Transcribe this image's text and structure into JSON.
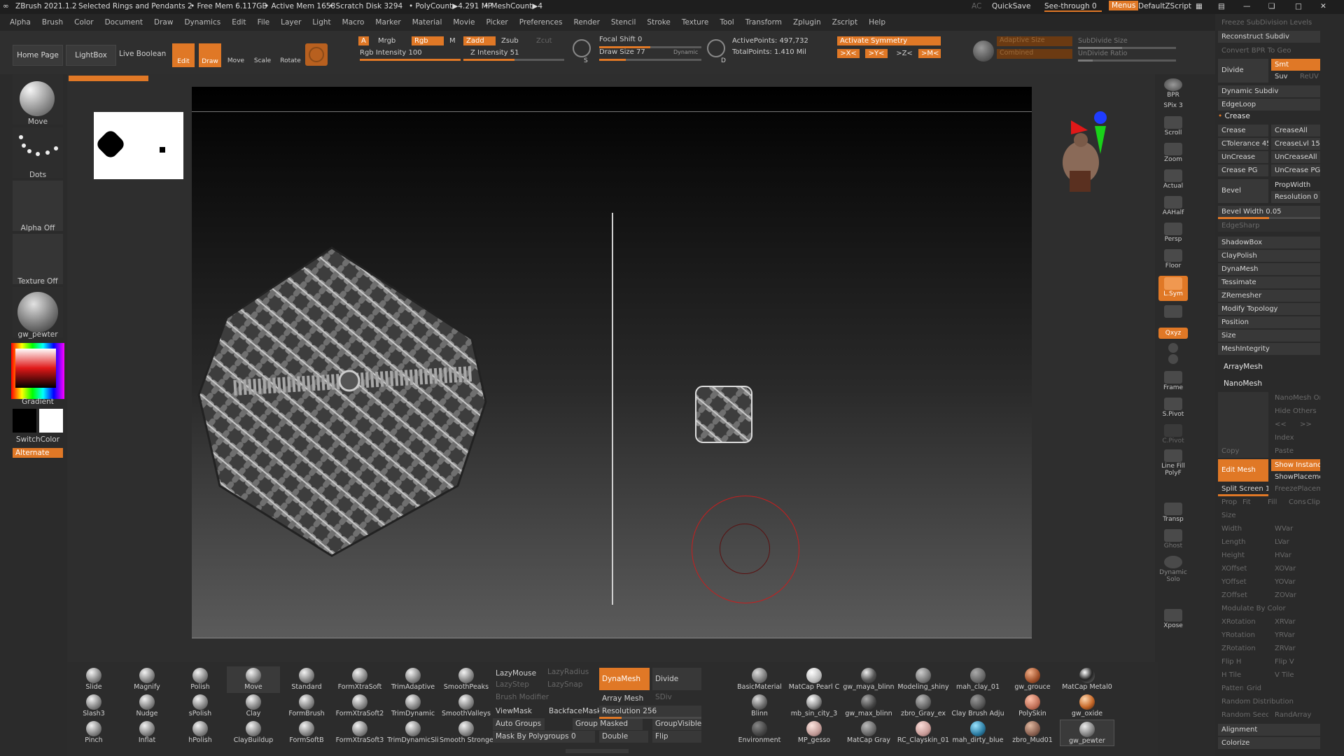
{
  "titlebar": {
    "app": "ZBrush 2021.1.2",
    "document": "Selected Rings and Pendants 2",
    "free_mem": "• Free Mem 6.117GB",
    "active_mem": "• Active Mem 1658",
    "scratch": "• Scratch Disk 3294",
    "polycount": "• PolyCount▶4.291 MP",
    "meshcount": "• MeshCount▶4",
    "ac": "AC",
    "quicksave": "QuickSave",
    "seethrough": "See-through   0",
    "menus": "Menus",
    "zscript": "DefaultZScript"
  },
  "menu": [
    "Alpha",
    "Brush",
    "Color",
    "Document",
    "Draw",
    "Dynamics",
    "Edit",
    "File",
    "Layer",
    "Light",
    "Macro",
    "Marker",
    "Material",
    "Movie",
    "Picker",
    "Preferences",
    "Render",
    "Stencil",
    "Stroke",
    "Texture",
    "Tool",
    "Transform",
    "Zplugin",
    "Zscript",
    "Help"
  ],
  "topshelf": {
    "home": "Home Page",
    "lightbox": "LightBox",
    "liveboolean": "Live Boolean",
    "edit": "Edit",
    "draw": "Draw",
    "move": "Move",
    "scale": "Scale",
    "rotate": "Rotate",
    "a": "A",
    "mrgb": "Mrgb",
    "rgb": "Rgb",
    "m": "M",
    "zadd": "Zadd",
    "zsub": "Zsub",
    "zcut": "Zcut",
    "rgb_intensity": "Rgb Intensity 100",
    "z_intensity": "Z Intensity 51",
    "focal_shift": "Focal Shift 0",
    "draw_size": "Draw Size 77",
    "dynamic": "Dynamic",
    "active_points": "ActivePoints: 497,732",
    "total_points": "TotalPoints: 1.410 Mil",
    "activate_symmetry": "Activate Symmetry",
    "sym_x": ">X<",
    "sym_y": ">Y<",
    "sym_z": ">Z<",
    "sym_m": ">M<",
    "adaptive_size": "Adaptive Size",
    "combined": "Combined",
    "subdivide_size": "SubDivide Size",
    "undivide_ratio": "UnDivide Ratio"
  },
  "left": {
    "brush": "Move",
    "stroke": "Dots",
    "alpha": "Alpha Off",
    "texture": "Texture Off",
    "material": "gw_pewter",
    "gradient": "Gradient",
    "switchcolor": "SwitchColor",
    "alternate": "Alternate"
  },
  "rightstrip": [
    "BPR",
    "SPix 3",
    "Scroll",
    "Zoom",
    "Actual",
    "AAHalf",
    "Persp",
    "Floor",
    "L.Sym",
    "Qxyz",
    "Frame",
    "S.Pivot",
    "C.Pivot",
    "Line Fill PolyF",
    "Transp",
    "Ghost",
    "Dynamic Solo",
    "Xpose"
  ],
  "tray": {
    "freeze": "Freeze SubDivision Levels",
    "reconstruct": "Reconstruct Subdiv",
    "convert_bpr": "Convert BPR To Geo",
    "divide": "Divide",
    "smt": "Smt",
    "suv": "Suv",
    "reuv": "ReUV",
    "dynamic_subdiv": "Dynamic Subdiv",
    "edgeloop": "EdgeLoop",
    "crease_section": "Crease",
    "crease": "Crease",
    "creaseall": "CreaseAll",
    "ctolerance": "CTolerance 45",
    "creaselvl": "CreaseLvl 15",
    "uncrease": "UnCrease",
    "uncreaseall": "UnCreaseAll",
    "crease_pg": "Crease PG",
    "uncrease_pg": "UnCrease PG",
    "bevel": "Bevel",
    "propwidth": "PropWidth",
    "resolution": "Resolution 0",
    "bevel_width": "Bevel Width 0.05",
    "edgesharp": "EdgeSharp",
    "sections": [
      "ShadowBox",
      "ClayPolish",
      "DynaMesh",
      "Tessimate",
      "ZRemesher",
      "Modify Topology",
      "Position",
      "Size",
      "MeshIntegrity"
    ],
    "arraymesh": "ArrayMesh",
    "nanomesh": "NanoMesh",
    "nanomesh_on": "NanoMesh On",
    "hide_others": "Hide Others",
    "prev": "<<",
    "next": ">>",
    "index": "Index",
    "copy": "Copy",
    "paste": "Paste",
    "edit_mesh": "Edit Mesh",
    "show_instance": "Show Instance",
    "show_placement": "ShowPlacement",
    "split_screen": "Split Screen 1",
    "freeze_placement": "FreezePlacement",
    "prop": "Prop",
    "fit": "Fit",
    "fill": "Fill",
    "cons": "Cons",
    "clip": "Clip",
    "size": "Size",
    "left_sliders": [
      "Width",
      "Length",
      "Height",
      "XOffset",
      "YOffset",
      "ZOffset"
    ],
    "right_sliders": [
      "WVar",
      "LVar",
      "HVar",
      "XOVar",
      "YOVar",
      "ZOVar"
    ],
    "modulate": "Modulate By Color",
    "rot_left": [
      "XRotation",
      "YRotation",
      "ZRotation"
    ],
    "rot_right": [
      "XRVar",
      "YRVar",
      "ZRVar"
    ],
    "fliph": "Flip H",
    "flipv": "Flip V",
    "htile": "H Tile",
    "vtile": "V Tile",
    "pattern": "Pattern",
    "grid": "Grid",
    "random_dist": "Random Distribution",
    "random_seed": "Random Seed",
    "randarray": "RandArray",
    "alignment": "Alignment",
    "colorize": "Colorize"
  },
  "bottom": {
    "brushes": [
      [
        "Slide",
        "Magnify",
        "Polish",
        "Move",
        "Standard",
        "FormXtraSoft",
        "TrimAdaptive",
        "SmoothPeaks"
      ],
      [
        "Slash3",
        "Nudge",
        "sPolish",
        "Clay",
        "FormBrush",
        "FormXtraSoft2",
        "TrimDynamic",
        "SmoothValleys"
      ],
      [
        "Pinch",
        "Inflat",
        "hPolish",
        "ClayBuildup",
        "FormSoftB",
        "FormXtraSoft3",
        "TrimDynamicSli",
        "Smooth Stronger"
      ]
    ],
    "lazymouse": "LazyMouse",
    "lazyradius": "LazyRadius",
    "lazystep": "LazyStep",
    "lazysnap": "LazySnap",
    "brush_modifier": "Brush Modifier",
    "sdiv": "SDiv",
    "viewmask": "ViewMask",
    "backfacemask": "BackfaceMask",
    "auto_groups": "Auto Groups",
    "group_masked": "Group Masked",
    "groupvisible": "GroupVisible",
    "mask_by_polygroups": "Mask By Polygroups 0",
    "dynamesh": "DynaMesh",
    "divide": "Divide",
    "array_mesh": "Array Mesh",
    "resolution": "Resolution 256",
    "double": "Double",
    "flip": "Flip",
    "materials": [
      [
        "BasicMaterial",
        "MatCap Pearl C",
        "gw_maya_blinn",
        "Modeling_shiny",
        "mah_clay_01",
        "gw_grouce",
        "MatCap Metal0"
      ],
      [
        "Blinn",
        "mb_sin_city_3",
        "gw_max_blinn",
        "zbro_Gray_ex",
        "Clay Brush Adju",
        "PolySkin",
        "gw_oxide"
      ],
      [
        "Environment",
        "MP_gesso",
        "MatCap Gray",
        "RC_Clayskin_01",
        "mah_dirty_blue",
        "zbro_Mud01",
        "gw_pewter"
      ]
    ]
  },
  "colors": {
    "accent": "#e07826",
    "background": "#2b2b2b",
    "cursor_ring": "#c81e1e"
  }
}
